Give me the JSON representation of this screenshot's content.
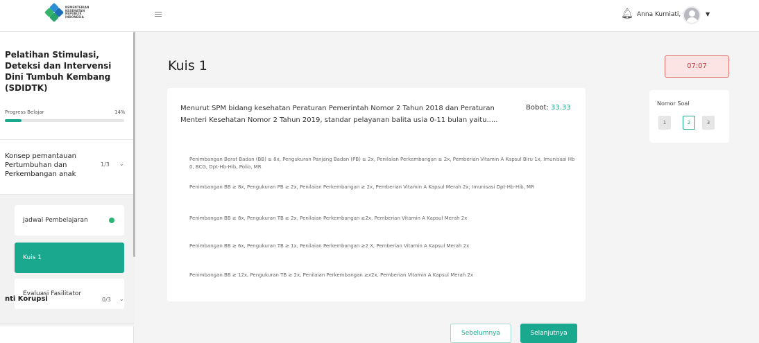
{
  "header": {
    "logo_text": "KEMENTERIAN KESEHATAN REPUBLIK INDONESIA",
    "user_name": "Anna Kurniati, S ...",
    "icons": {
      "menu": "hamburger-icon",
      "notification": "bell-icon",
      "user_menu": "chevron-down-icon"
    }
  },
  "sidebar": {
    "course_title": "Pelatihan Stimulasi, Deteksi dan Intervensi Dini Tumbuh Kembang (SDIDTK)",
    "progress_label": "Progress Belajar",
    "progress_value": "14%",
    "progress_fraction": 0.14,
    "module": {
      "title": "Konsep pemantauan Pertumbuhan dan Perkembangan anak",
      "count": "1/3"
    },
    "items": [
      {
        "label": "Jadwal Pembelajaran",
        "completed": true
      },
      {
        "label": "Kuis 1",
        "active": true
      },
      {
        "label": "Evaluasi Fasilitator"
      }
    ],
    "module2": {
      "title": "nti Korupsi",
      "count": "0/3"
    }
  },
  "main": {
    "title": "Kuis 1",
    "timer": "07:07",
    "question": {
      "text": "Menurut SPM bidang kesehatan Peraturan Pemerintah Nomor 2 Tahun 2018 dan Peraturan Menteri Kesehatan Nomor 2 Tahun 2019, standar pelayanan balita usia 0-11 bulan yaitu.....",
      "bobot_label": "Bobot:",
      "bobot_value": "33.33",
      "options": [
        "Penimbangan Berat Badan (BB) ≥ 8x, Pengukuran Panjang Badan (PB) ≥ 2x, Penilaian Perkembangan ≥ 2x, Pemberian Vitamin A Kapsul Biru 1x, Imunisasi Hb 0, BCG, Dpt-Hb-Hib, Polio, MR",
        "Penimbangan BB ≥ 8x, Pengukuran PB ≥ 2x, Penilaian Perkembangan ≥ 2x, Pemberian Vitamin A Kapsul Merah 2x; Imunisasi Dpt-Hb-Hib, MR",
        "Penimbangan BB ≥ 8x, Pengukuran TB ≥ 2x, Penilaian Perkembangan ≥2x, Pemberian Vitamin A Kapsul Merah 2x",
        "Penimbangan BB ≥ 6x, Pengukuran TB ≥ 1x, Penilaian Perkembangan ≥2 X, Pemberian Vitamin A Kapsul Merah 2x",
        "Penimbangan BB ≥ 12x, Pengukuran TB ≥ 2x, Penilaian Perkembangan ≥x2x, Pemberian Vitamin A Kapsul Merah 2x"
      ]
    },
    "navigator": {
      "title": "Nomor Soal",
      "numbers": [
        "1",
        "2",
        "3"
      ],
      "current": "2"
    },
    "buttons": {
      "prev": "Sebelumnya",
      "next": "Selanjutnya"
    }
  },
  "colors": {
    "accent": "#1aa88f",
    "timer_bg": "#fde4e4",
    "timer_text": "#c53a3a"
  }
}
